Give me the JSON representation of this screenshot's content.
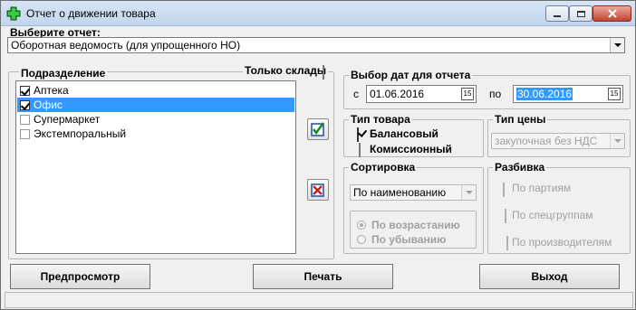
{
  "window": {
    "title": "Отчет о движении товара",
    "icon": "green-plus-icon"
  },
  "report": {
    "label": "Выберите отчет:",
    "selected": "Оборотная ведомость (для упрощенного НО)"
  },
  "departments": {
    "header": "Подразделение",
    "only_warehouses_label": "Только склады",
    "only_warehouses_checked": false,
    "items": [
      {
        "label": "Аптека",
        "checked": true,
        "selected": false
      },
      {
        "label": "Офис",
        "checked": true,
        "selected": true
      },
      {
        "label": "Супермаркет",
        "checked": false,
        "selected": false
      },
      {
        "label": "Экстемпоральный",
        "checked": false,
        "selected": false
      }
    ]
  },
  "side_buttons": {
    "select_all_icon": "check-all-icon",
    "clear_all_icon": "uncheck-all-icon"
  },
  "dates": {
    "group_title": "Выбор дат для отчета",
    "from_label": "с",
    "from_value": "01.06.2016",
    "to_label": "по",
    "to_value": "30.06.2016",
    "calendar_icon_text": "15"
  },
  "product_type": {
    "group_title": "Тип товара",
    "options": [
      {
        "label": "Балансовый",
        "checked": true
      },
      {
        "label": "Комиссионный",
        "checked": false
      }
    ]
  },
  "price_type": {
    "group_title": "Тип цены",
    "selected": "закупочная без НДС"
  },
  "sorting": {
    "group_title": "Сортировка",
    "selected": "По наименованию",
    "order": [
      {
        "label": "По возрастанию",
        "checked": true
      },
      {
        "label": "По убыванию",
        "checked": false
      }
    ]
  },
  "breakdown": {
    "group_title": "Разбивка",
    "options": [
      {
        "label": "По партиям",
        "checked": false
      },
      {
        "label": "По спецгруппам",
        "checked": false
      },
      {
        "label": "По производителям",
        "checked": false
      }
    ]
  },
  "buttons": {
    "preview": "Предпросмотр",
    "print": "Печать",
    "exit": "Выход"
  }
}
